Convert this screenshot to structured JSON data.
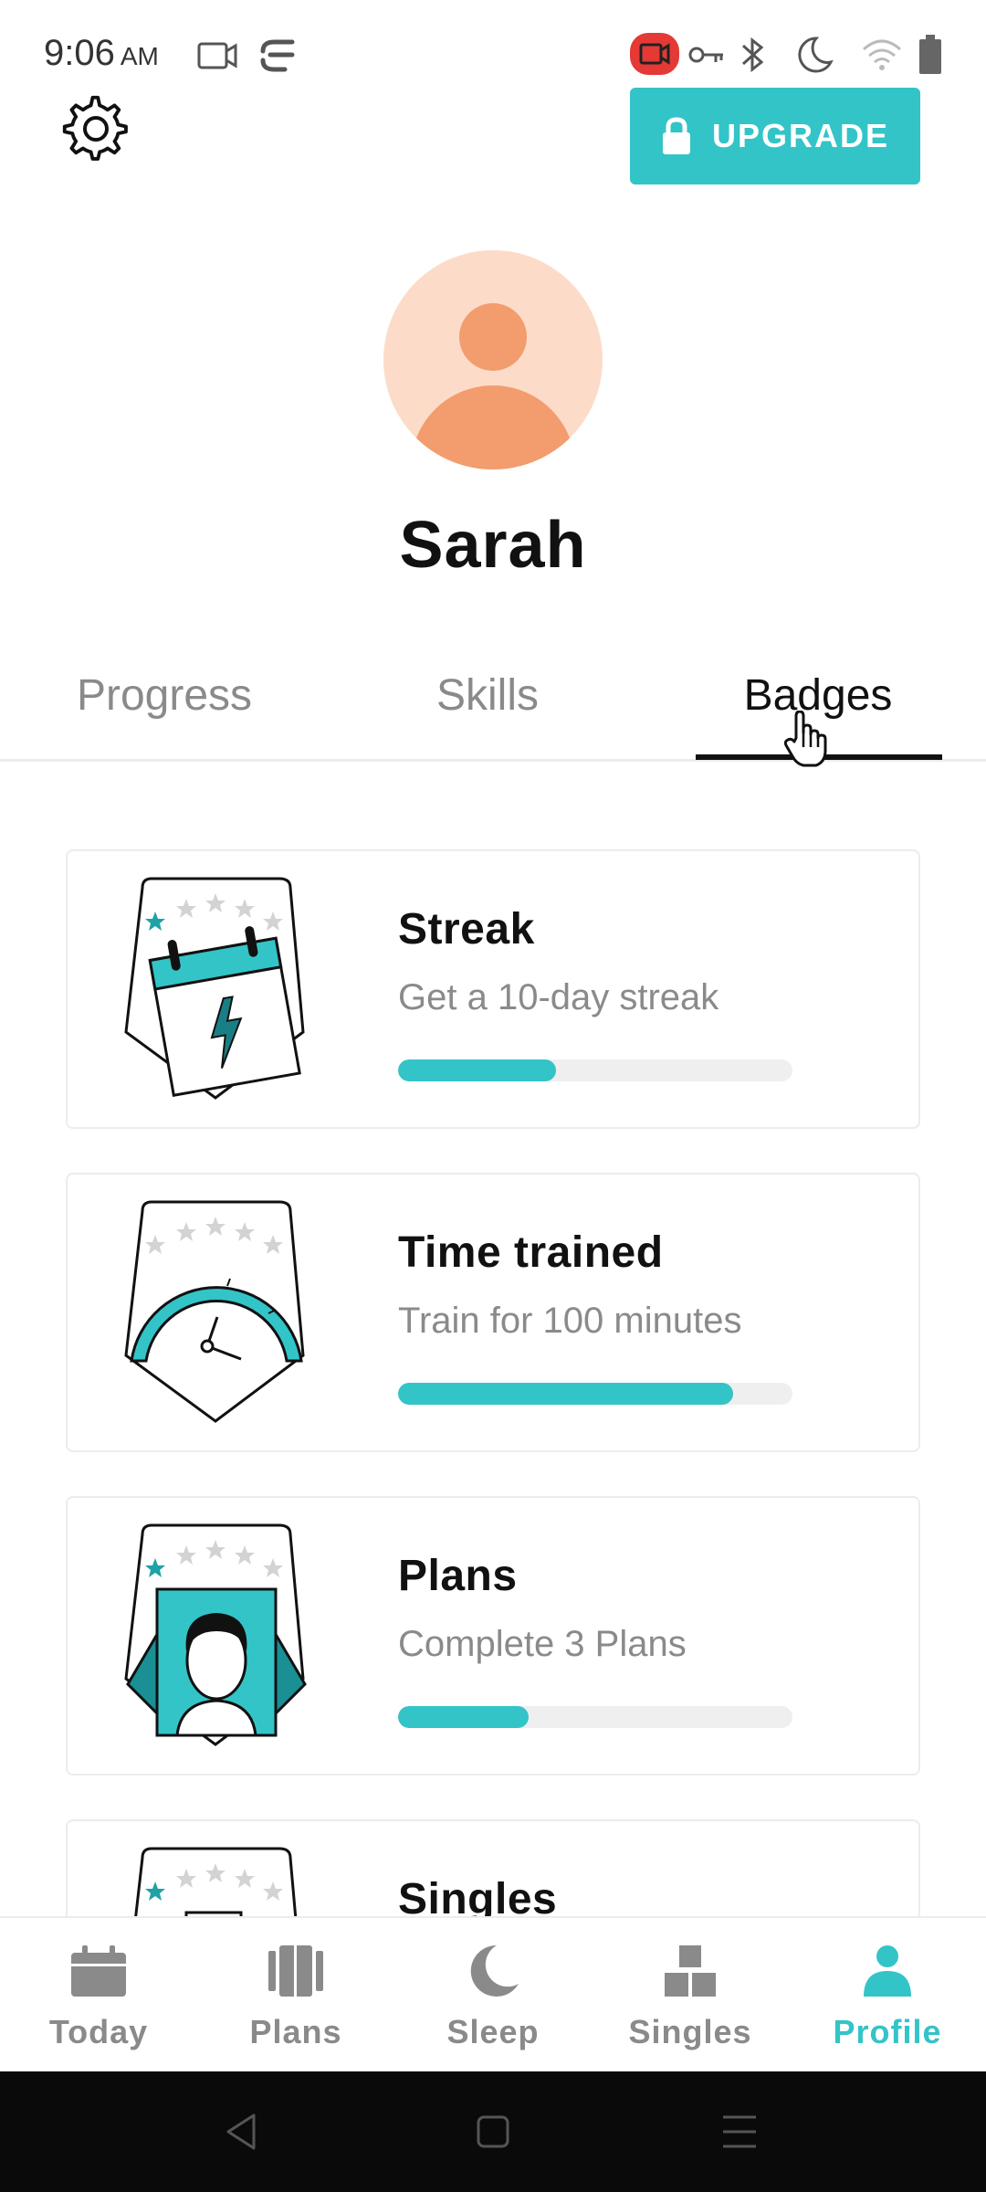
{
  "status_bar": {
    "time": "9:06",
    "ampm": "AM",
    "icons": [
      "video-icon",
      "link-icon",
      "screen-record-icon",
      "key-icon",
      "bluetooth-icon",
      "moon-icon",
      "wifi-icon",
      "battery-icon"
    ]
  },
  "header": {
    "settings_icon": "gear-icon",
    "upgrade_label": "UPGRADE",
    "upgrade_icon": "lock-icon",
    "accent_color": "#33c4c8"
  },
  "profile": {
    "name": "Sarah"
  },
  "tabs": [
    {
      "label": "Progress",
      "active": false
    },
    {
      "label": "Skills",
      "active": false
    },
    {
      "label": "Badges",
      "active": true
    }
  ],
  "badges": [
    {
      "title": "Streak",
      "description": "Get a 10-day streak",
      "progress": 0.4,
      "icon": "calendar-bolt-icon"
    },
    {
      "title": "Time trained",
      "description": "Train for 100 minutes",
      "progress": 0.85,
      "icon": "clock-icon"
    },
    {
      "title": "Plans",
      "description": "Complete 3 Plans",
      "progress": 0.33,
      "icon": "plans-face-icon"
    },
    {
      "title": "Singles",
      "description": "",
      "progress": 0,
      "icon": "singles-icon"
    }
  ],
  "bottom_nav": [
    {
      "label": "Today",
      "icon": "calendar-icon",
      "active": false
    },
    {
      "label": "Plans",
      "icon": "plans-icon",
      "active": false
    },
    {
      "label": "Sleep",
      "icon": "moon-icon",
      "active": false
    },
    {
      "label": "Singles",
      "icon": "blocks-icon",
      "active": false
    },
    {
      "label": "Profile",
      "icon": "person-icon",
      "active": true
    }
  ]
}
